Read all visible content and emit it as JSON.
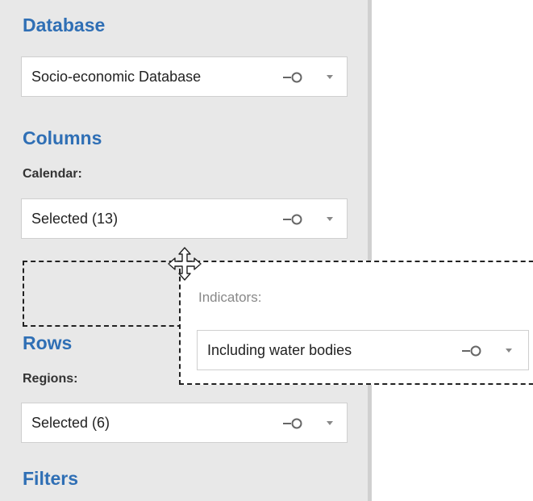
{
  "sections": {
    "database_title": "Database",
    "columns_title": "Columns",
    "rows_title": "Rows",
    "filters_title": "Filters"
  },
  "database_select": {
    "value": "Socio-economic Database"
  },
  "calendar": {
    "label": "Calendar:",
    "value": "Selected (13)"
  },
  "regions": {
    "label": "Regions:",
    "value": "Selected (6)"
  },
  "dragged_card": {
    "label": "Indicators:",
    "value": "Including water bodies"
  },
  "icons": {
    "pin": "pin-icon",
    "caret": "chevron-down-icon",
    "move": "move-cursor-icon"
  },
  "colors": {
    "section_title": "#2f6fb5",
    "panel_bg": "#e8e8e8"
  }
}
